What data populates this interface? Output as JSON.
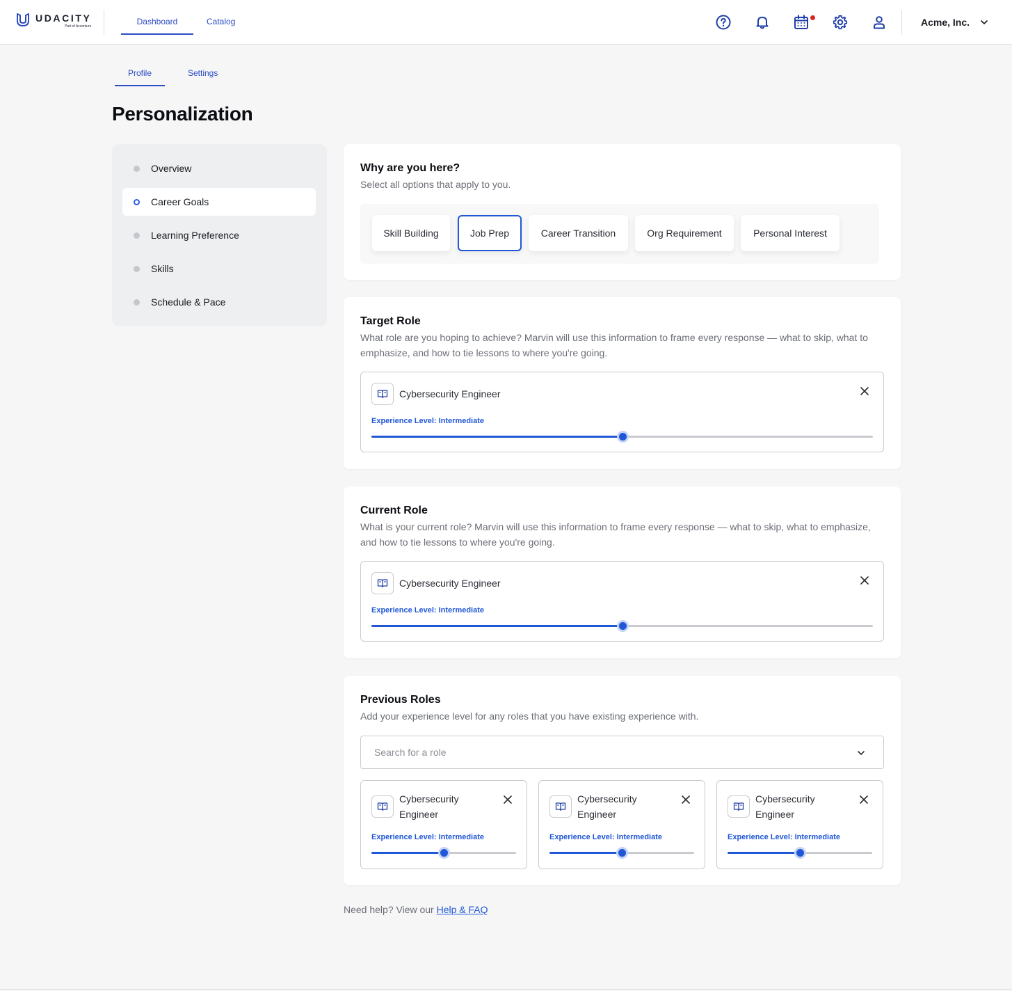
{
  "brand": {
    "name": "UDACITY",
    "sub": "Part of Accenture"
  },
  "nav": {
    "tabs": [
      {
        "label": "Dashboard"
      },
      {
        "label": "Catalog"
      }
    ]
  },
  "header": {
    "org_name": "Acme, Inc.",
    "icons": [
      "help-icon",
      "bell-icon",
      "calendar-icon",
      "gear-icon",
      "user-icon"
    ]
  },
  "subtabs": [
    {
      "label": "Profile"
    },
    {
      "label": "Settings"
    }
  ],
  "page": {
    "title": "Personalization"
  },
  "sidebar": {
    "items": [
      {
        "label": "Overview"
      },
      {
        "label": "Career Goals"
      },
      {
        "label": "Learning Preference"
      },
      {
        "label": "Skills"
      },
      {
        "label": "Schedule & Pace"
      }
    ]
  },
  "why": {
    "title": "Why are you here?",
    "desc": "Select all options that apply to you.",
    "options": [
      {
        "label": "Skill Building"
      },
      {
        "label": "Job Prep"
      },
      {
        "label": "Career Transition"
      },
      {
        "label": "Org Requirement"
      },
      {
        "label": "Personal Interest"
      }
    ],
    "selected": "Job Prep"
  },
  "target": {
    "title": "Target Role",
    "desc": "What role are you hoping to achieve? Marvin will use this information to frame every response — what to skip, what to emphasize, and how to tie lessons to where you're going.",
    "role": "Cybersecurity Engineer",
    "exp_label": "Experience Level: Intermediate",
    "level": 0.5
  },
  "current": {
    "title": "Current Role",
    "desc": "What is your current role? Marvin will use this information to frame every response — what to skip, what to emphasize, and how to tie lessons to where you're going.",
    "role": "Cybersecurity Engineer",
    "exp_label": "Experience Level: Intermediate",
    "level": 0.5
  },
  "previous": {
    "title": "Previous Roles",
    "desc": "Add your experience level for any roles that you have existing experience with.",
    "search_placeholder": "Search for a role",
    "roles": [
      {
        "name_line1": "Cybersecurity",
        "name_line2": "Engineer",
        "exp_label": "Experience Level: Intermediate",
        "level": 0.5
      },
      {
        "name_line1": "Cybersecurity",
        "name_line2": "Engineer",
        "exp_label": "Experience Level: Intermediate",
        "level": 0.5
      },
      {
        "name_line1": "Cybersecurity",
        "name_line2": "Engineer",
        "exp_label": "Experience Level: Intermediate",
        "level": 0.5
      }
    ]
  },
  "footer": {
    "help_text": "Need help? View our",
    "help_link": "Help & FAQ"
  },
  "colors": {
    "accent": "#1f57d6",
    "notification_dot": "#d8262b"
  }
}
